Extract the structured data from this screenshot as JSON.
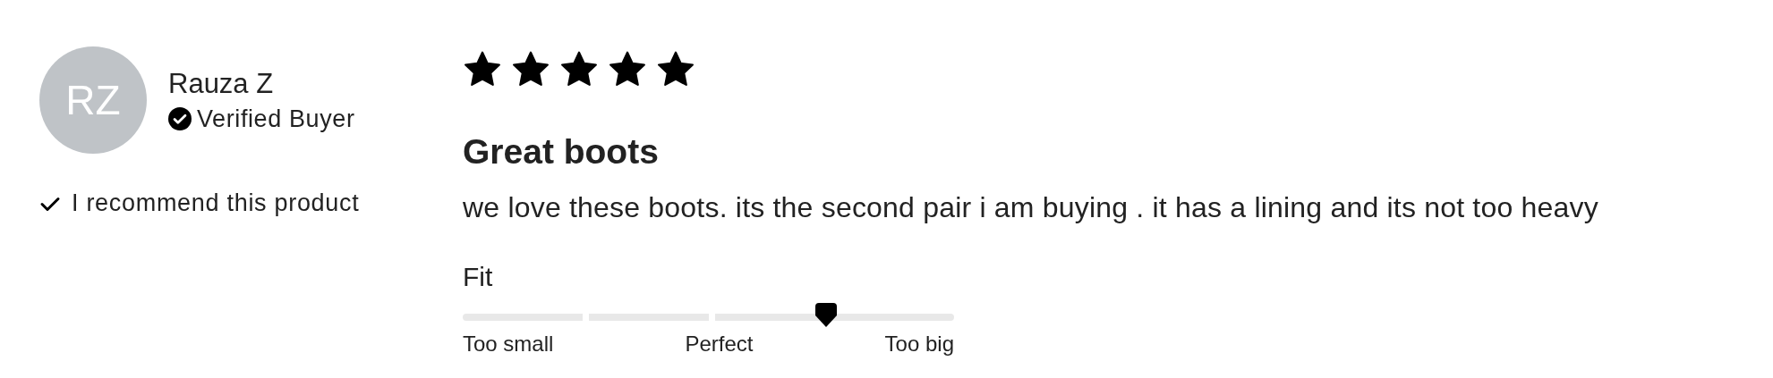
{
  "reviewer": {
    "initials": "RZ",
    "name": "Rauza Z",
    "badge": "Verified Buyer",
    "recommend": "I recommend this product"
  },
  "review": {
    "stars": 5,
    "title": "Great boots",
    "body": "we love these boots. its the second pair i am buying . it has a lining and its not too heavy"
  },
  "fit": {
    "label": "Fit",
    "level": 0.75,
    "scale_labels": [
      "Too small",
      "Perfect",
      "Too big"
    ]
  }
}
